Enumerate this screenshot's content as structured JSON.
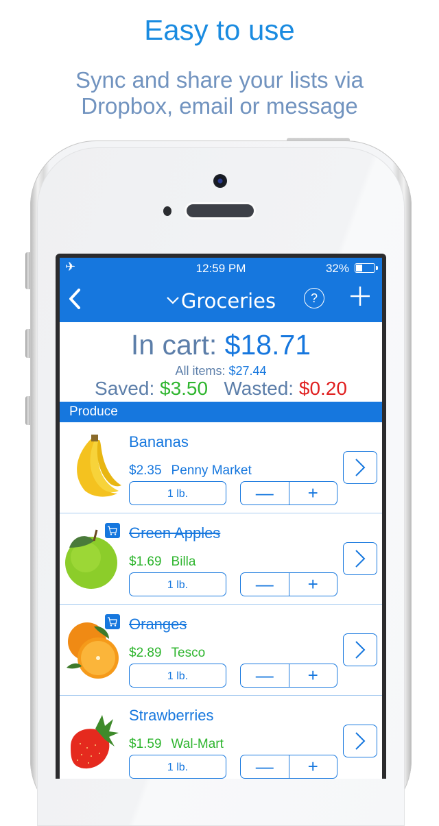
{
  "promo": {
    "headline": "Easy to use",
    "subline_1": "Sync and share your lists via",
    "subline_2": "Dropbox, email or message"
  },
  "status_bar": {
    "airplane_icon": "airplane-icon",
    "time": "12:59 PM",
    "battery_percent": "32%",
    "battery_level": 0.32
  },
  "nav": {
    "back_icon": "chevron-left-icon",
    "title_chevron": "⌄",
    "title": "Groceries",
    "help_label": "?",
    "add_icon": "plus-icon"
  },
  "summary": {
    "in_cart_label": "In cart:",
    "in_cart_value": "$18.71",
    "all_items_label": "All items:",
    "all_items_value": "$27.44",
    "saved_label": "Saved:",
    "saved_value": "$3.50",
    "wasted_label": "Wasted:",
    "wasted_value": "$0.20"
  },
  "section": {
    "title": "Produce"
  },
  "items": [
    {
      "name": "Bananas",
      "price": "$2.35",
      "store": "Penny Market",
      "qty": "1 lb.",
      "in_cart": false,
      "image": "banana-image"
    },
    {
      "name": "Green Apples",
      "price": "$1.69",
      "store": "Billa",
      "qty": "1 lb.",
      "in_cart": true,
      "image": "green-apple-image"
    },
    {
      "name": "Oranges",
      "price": "$2.89",
      "store": "Tesco",
      "qty": "1 lb.",
      "in_cart": true,
      "image": "orange-image"
    },
    {
      "name": "Strawberries",
      "price": "$1.59",
      "store": "Wal-Mart",
      "qty": "1 lb.",
      "in_cart": false,
      "image": "strawberry-image"
    }
  ],
  "stepper": {
    "minus": "—",
    "plus": "+"
  },
  "colors": {
    "accent": "#1677de",
    "headline": "#1a8be0",
    "label": "#5c7ea9",
    "saved": "#2eb52e",
    "wasted": "#e02020"
  }
}
